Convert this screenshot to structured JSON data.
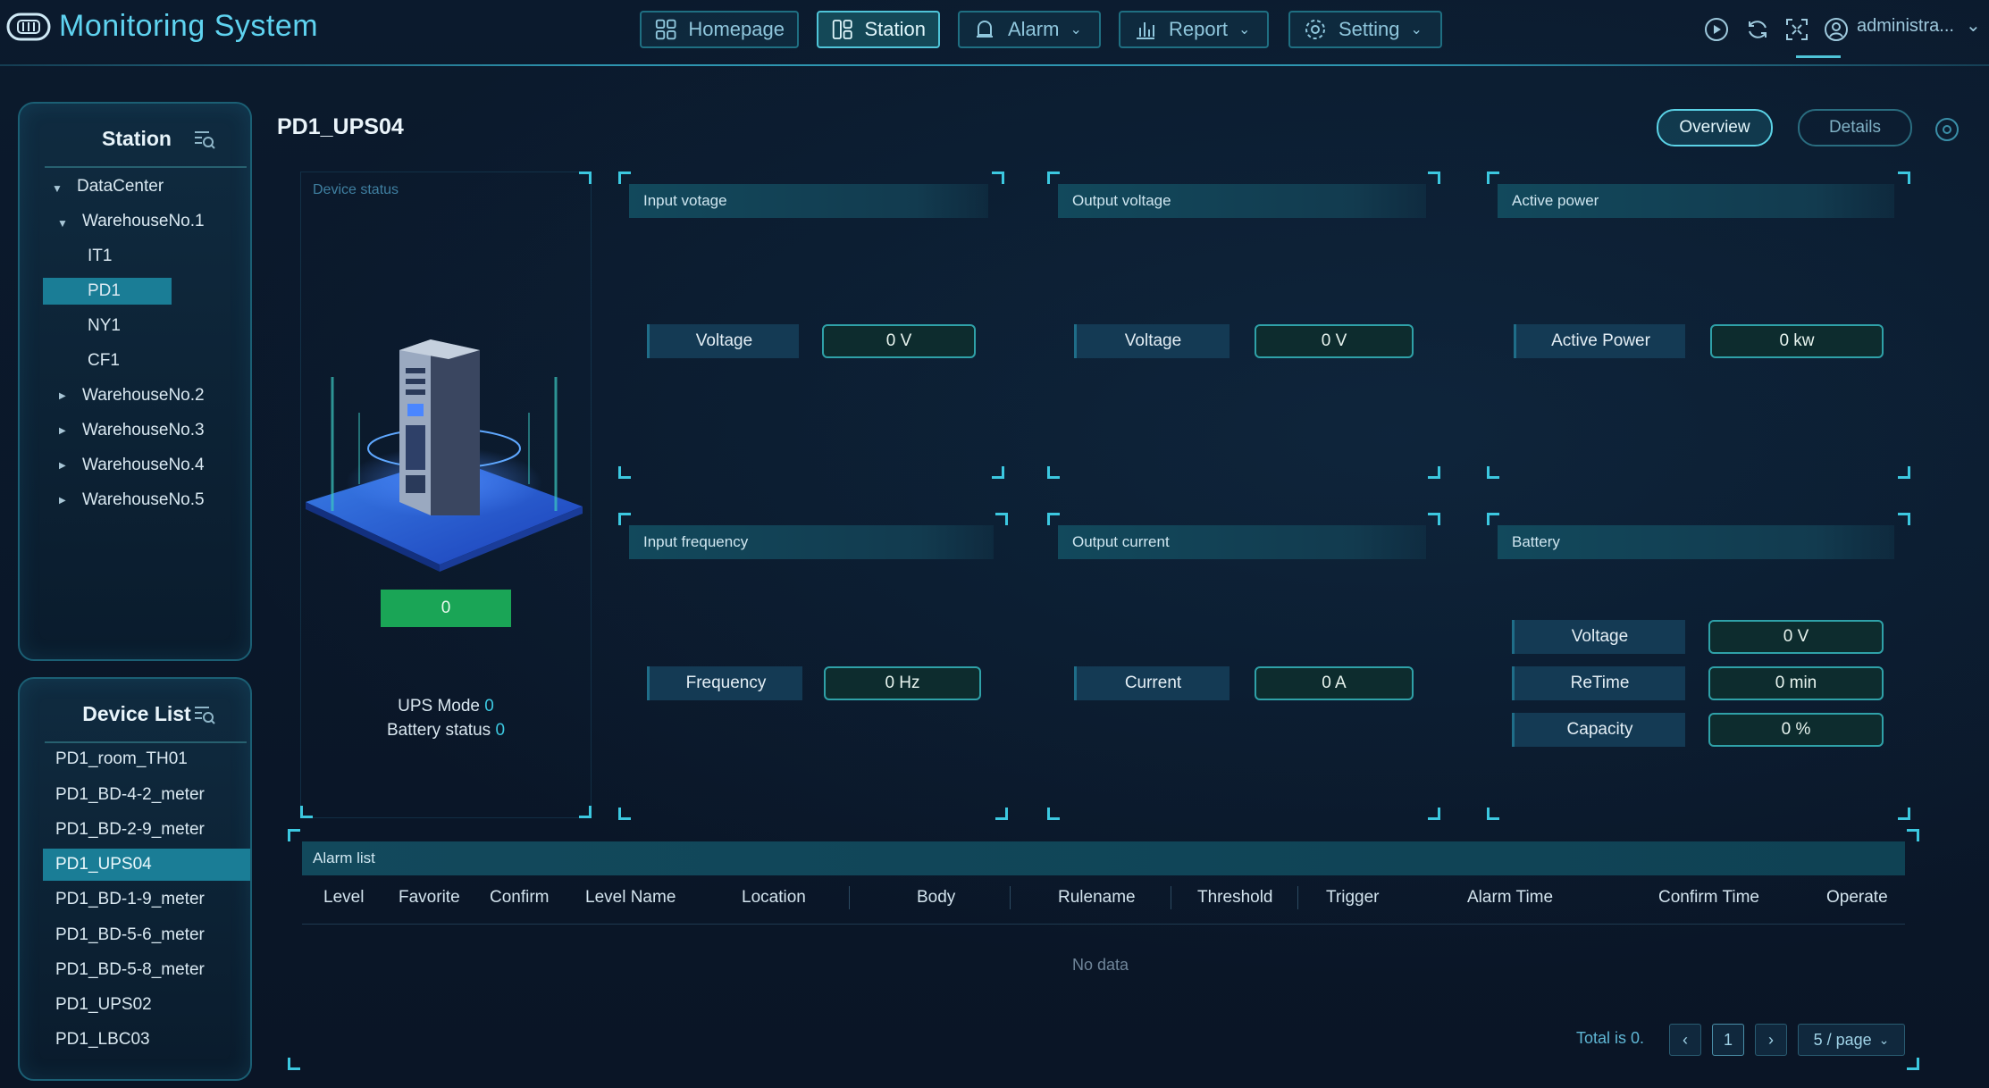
{
  "app": {
    "title": "Monitoring System",
    "user": "administra..."
  },
  "nav": [
    {
      "label": "Homepage",
      "icon": "grid-icon",
      "active": false
    },
    {
      "label": "Station",
      "icon": "layout-icon",
      "active": true
    },
    {
      "label": "Alarm",
      "icon": "bell-icon",
      "active": false
    },
    {
      "label": "Report",
      "icon": "bar-chart-icon",
      "active": false
    },
    {
      "label": "Setting",
      "icon": "gear-icon",
      "active": false
    }
  ],
  "station": {
    "title": "Station",
    "tree": [
      {
        "label": "DataCenter"
      },
      {
        "label": "WarehouseNo.1"
      },
      {
        "label": "IT1"
      },
      {
        "label": "PD1"
      },
      {
        "label": "NY1"
      },
      {
        "label": "CF1"
      },
      {
        "label": "WarehouseNo.2"
      },
      {
        "label": "WarehouseNo.3"
      },
      {
        "label": "WarehouseNo.4"
      },
      {
        "label": "WarehouseNo.5"
      }
    ]
  },
  "devices": {
    "title": "Device List",
    "items": [
      "PD1_room_TH01",
      "PD1_BD-4-2_meter",
      "PD1_BD-2-9_meter",
      "PD1_UPS04",
      "PD1_BD-1-9_meter",
      "PD1_BD-5-6_meter",
      "PD1_BD-5-8_meter",
      "PD1_UPS02",
      "PD1_LBC03"
    ]
  },
  "page": {
    "title": "PD1_UPS04",
    "overview": "Overview",
    "details": "Details"
  },
  "device_status": {
    "title": "Device status",
    "value": "0",
    "ups_mode_label": "UPS Mode",
    "ups_mode_value": "0",
    "battery_label": "Battery status",
    "battery_value": "0"
  },
  "cards": {
    "input_voltage": {
      "title": "Input votage",
      "label": "Voltage",
      "value": "0 V"
    },
    "output_voltage": {
      "title": "Output voltage",
      "label": "Voltage",
      "value": "0 V"
    },
    "active_power": {
      "title": "Active power",
      "label": "Active Power",
      "value": "0 kw"
    },
    "input_frequency": {
      "title": "Input frequency",
      "label": "Frequency",
      "value": "0 Hz"
    },
    "output_current": {
      "title": "Output current",
      "label": "Current",
      "value": "0 A"
    },
    "battery": {
      "title": "Battery",
      "rows": [
        {
          "label": "Voltage",
          "value": "0 V"
        },
        {
          "label": "ReTime",
          "value": "0 min"
        },
        {
          "label": "Capacity",
          "value": "0 %"
        }
      ]
    }
  },
  "alarm": {
    "title": "Alarm list",
    "columns": [
      "Level",
      "Favorite",
      "Confirm",
      "Level Name",
      "Location",
      "Body",
      "Rulename",
      "Threshold",
      "Trigger",
      "Alarm Time",
      "Confirm Time",
      "Operate"
    ],
    "empty": "No data",
    "total": "Total is 0.",
    "page": "1",
    "page_size": "5 / page"
  },
  "colors": {
    "accent": "#3cc8e0",
    "selected": "#1a7d96",
    "status_green": "#1aa556",
    "title": "#5fd3f0"
  }
}
